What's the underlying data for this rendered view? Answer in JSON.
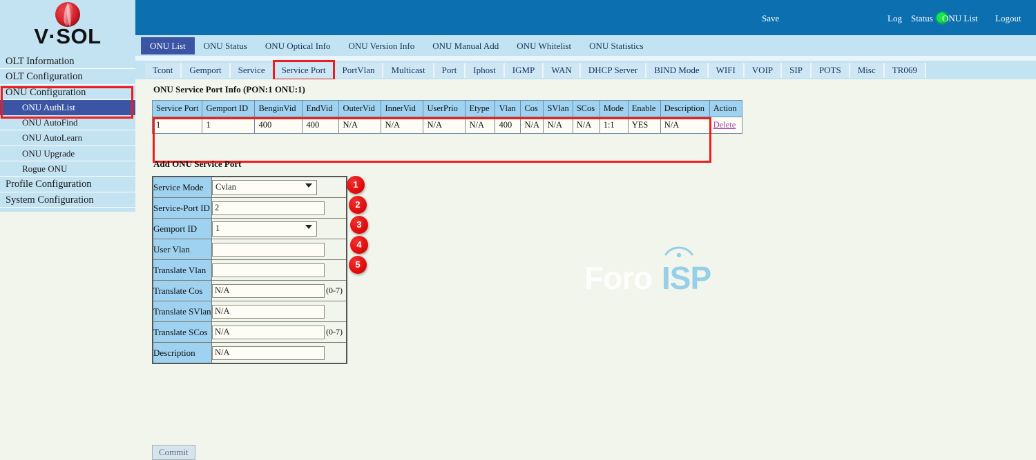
{
  "brand": {
    "logo_text": "V·SOL",
    "logo_icon": "vsol-sphere-logo"
  },
  "header": {
    "save_label": "Save",
    "status_led": "green-status-led",
    "links": [
      {
        "label": "Log"
      },
      {
        "label": "Status"
      },
      {
        "label": "ONU List"
      },
      {
        "label": "Logout"
      }
    ],
    "colors": {
      "bar": "#0c6fb0",
      "led": "#16e74a"
    }
  },
  "sidebar": {
    "items": [
      {
        "label": "OLT Information",
        "level": "top",
        "active": false
      },
      {
        "label": "OLT Configuration",
        "level": "top",
        "active": false
      },
      {
        "label": "ONU Configuration",
        "level": "top",
        "active": false,
        "highlighted": true
      },
      {
        "label": "ONU AuthList",
        "level": "sub",
        "active": true
      },
      {
        "label": "ONU AutoFind",
        "level": "sub",
        "active": false
      },
      {
        "label": "ONU AutoLearn",
        "level": "sub",
        "active": false
      },
      {
        "label": "ONU Upgrade",
        "level": "sub",
        "active": false
      },
      {
        "label": "Rogue ONU",
        "level": "sub",
        "active": false
      },
      {
        "label": "Profile Configuration",
        "level": "top",
        "active": false
      },
      {
        "label": "System Configuration",
        "level": "top",
        "active": false
      }
    ],
    "colors": {
      "bg": "#c3e2f2",
      "active": "#3b55a4",
      "highlight": "#ef1c1c"
    }
  },
  "tabs_primary": [
    {
      "label": "ONU List",
      "active": true
    },
    {
      "label": "ONU Status",
      "active": false
    },
    {
      "label": "ONU Optical Info",
      "active": false
    },
    {
      "label": "ONU Version Info",
      "active": false
    },
    {
      "label": "ONU Manual Add",
      "active": false
    },
    {
      "label": "ONU Whitelist",
      "active": false
    },
    {
      "label": "ONU Statistics",
      "active": false
    }
  ],
  "tabs_secondary": [
    {
      "label": "Tcont",
      "active": false
    },
    {
      "label": "Gemport",
      "active": false
    },
    {
      "label": "Service",
      "active": false
    },
    {
      "label": "Service Port",
      "active": true
    },
    {
      "label": "PortVlan",
      "active": false
    },
    {
      "label": "Multicast",
      "active": false
    },
    {
      "label": "Port",
      "active": false
    },
    {
      "label": "Iphost",
      "active": false
    },
    {
      "label": "IGMP",
      "active": false
    },
    {
      "label": "WAN",
      "active": false
    },
    {
      "label": "DHCP Server",
      "active": false
    },
    {
      "label": "BIND Mode",
      "active": false
    },
    {
      "label": "WIFI",
      "active": false
    },
    {
      "label": "VOIP",
      "active": false
    },
    {
      "label": "SIP",
      "active": false
    },
    {
      "label": "POTS",
      "active": false
    },
    {
      "label": "Misc",
      "active": false
    },
    {
      "label": "TR069",
      "active": false
    }
  ],
  "info_section": {
    "title": "ONU Service Port Info (PON:1 ONU:1)",
    "columns": [
      "Service Port",
      "Gemport ID",
      "BenginVid",
      "EndVid",
      "OuterVid",
      "InnerVid",
      "UserPrio",
      "Etype",
      "Vlan",
      "Cos",
      "SVlan",
      "SCos",
      "Mode",
      "Enable",
      "Description",
      "Action"
    ],
    "rows": [
      {
        "cells": [
          "1",
          "1",
          "400",
          "400",
          "N/A",
          "N/A",
          "N/A",
          "N/A",
          "400",
          "N/A",
          "N/A",
          "N/A",
          "1:1",
          "YES",
          "N/A"
        ],
        "action_label": "Delete"
      }
    ]
  },
  "add_section": {
    "title": "Add ONU Service Port",
    "fields": [
      {
        "label": "Service Mode",
        "type": "select",
        "value": "Cvlan",
        "hint": "",
        "badge": "1"
      },
      {
        "label": "Service-Port ID",
        "type": "text",
        "value": "2",
        "hint": "",
        "badge": "2"
      },
      {
        "label": "Gemport ID",
        "type": "select",
        "value": "1",
        "hint": "",
        "badge": "3"
      },
      {
        "label": "User Vlan",
        "type": "text",
        "value": "",
        "hint": "",
        "badge": "4"
      },
      {
        "label": "Translate Vlan",
        "type": "text",
        "value": "",
        "hint": "",
        "badge": "5"
      },
      {
        "label": "Translate Cos",
        "type": "text",
        "value": "N/A",
        "hint": "(0-7)",
        "badge": ""
      },
      {
        "label": "Translate SVlan",
        "type": "text",
        "value": "N/A",
        "hint": "",
        "badge": ""
      },
      {
        "label": "Translate SCos",
        "type": "text",
        "value": "N/A",
        "hint": "(0-7)",
        "badge": ""
      },
      {
        "label": "Description",
        "type": "text",
        "value": "N/A",
        "hint": "",
        "badge": ""
      }
    ],
    "commit_label": "Commit"
  },
  "watermark": {
    "text_left": "Foro",
    "text_right": "ISP",
    "icon": "signal-tower-icon",
    "color": "#95cfe8"
  }
}
